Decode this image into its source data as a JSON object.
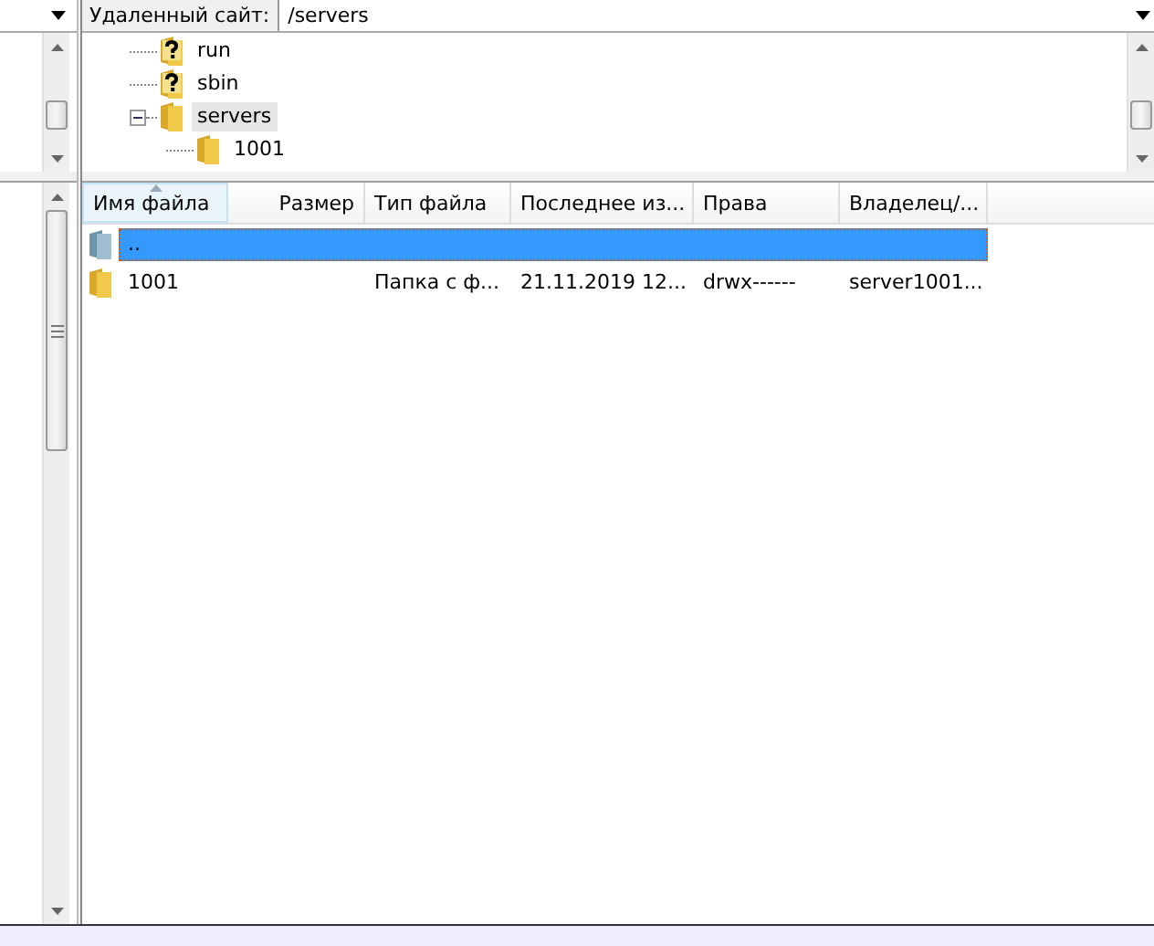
{
  "remote_site": {
    "label": "Удаленный сайт:",
    "value": "/servers"
  },
  "tree": [
    {
      "name": "run",
      "kind": "unknown",
      "selected": false
    },
    {
      "name": "sbin",
      "kind": "unknown",
      "selected": false
    },
    {
      "name": "servers",
      "kind": "folder",
      "selected": true,
      "expanded": true,
      "children": [
        {
          "name": "1001",
          "kind": "folder",
          "selected": false
        }
      ]
    }
  ],
  "columns": [
    {
      "label": "Имя файла",
      "sorted": true
    },
    {
      "label": "Размер",
      "sorted": false
    },
    {
      "label": "Тип файла",
      "sorted": false
    },
    {
      "label": "Последнее из...",
      "sorted": false
    },
    {
      "label": "Права",
      "sorted": false
    },
    {
      "label": "Владелец/...",
      "sorted": false
    }
  ],
  "rows": [
    {
      "kind": "parent",
      "selected": true,
      "cells": [
        "..",
        "",
        "",
        "",
        "",
        ""
      ]
    },
    {
      "kind": "folder",
      "selected": false,
      "cells": [
        "1001",
        "",
        "Папка с ф...",
        "21.11.2019 12...",
        "drwx------",
        "server1001..."
      ]
    }
  ]
}
